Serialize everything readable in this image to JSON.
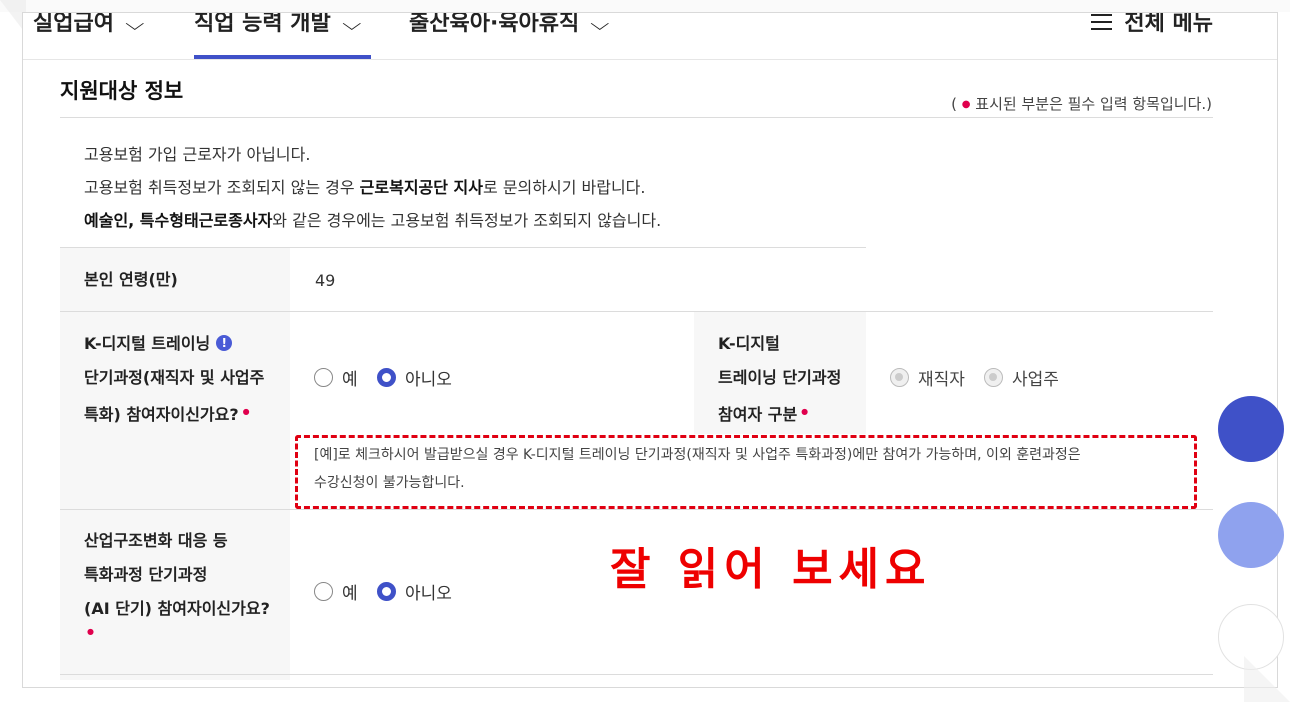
{
  "nav": {
    "items": [
      {
        "label": "실업급여"
      },
      {
        "label": "직업 능력 개발"
      },
      {
        "label": "출산육아·육아휴직"
      }
    ],
    "chevron": "⌵",
    "menu_label": "전체 메뉴"
  },
  "section": {
    "title": "지원대상 정보",
    "required_note_prefix": "(",
    "required_note_text": "표시된 부분은 필수 입력 항목입니다.)"
  },
  "notice": {
    "line1": "고용보험 가입 근로자가 아닙니다.",
    "line2_pre": "고용보험 취득정보가 조회되지 않는 경우 ",
    "line2_bold": "근로복지공단 지사",
    "line2_post": "로 문의하시기 바랍니다.",
    "line3_bold": "예술인, 특수형태근로종사자",
    "line3_post": "와 같은 경우에는 고용보험 취득정보가 조회되지 않습니다."
  },
  "table": {
    "age_label": "본인 연령(만)",
    "age_value": "49",
    "kdigital": {
      "label_l1": "K-디지털 트레이닝",
      "label_l2": "단기과정(재직자 및 사업주",
      "label_l3": "특화) 참여자이신가요?",
      "yes": "예",
      "no": "아니오",
      "selected": "아니오",
      "type_label_l1": "K-디지털",
      "type_label_l2": "트레이닝 단기과정",
      "type_label_l3": "참여자 구분",
      "type_opt1": "재직자",
      "type_opt2": "사업주",
      "info_glyph": "!",
      "notice_l1": "[예]로 체크하시어 발급받으실 경우 K-디지털 트레이닝 단기과정(재직자 및 사업주 특화과정)에만 참여가 가능하며, 이외 훈련과정은",
      "notice_l2": "수강신청이 불가능합니다."
    },
    "industry": {
      "label_l1": "산업구조변화 대응 등",
      "label_l2": "특화과정 단기과정",
      "label_l3": "(AI 단기) 참여자이신가요?",
      "yes": "예",
      "no": "아니오",
      "selected": "아니오"
    }
  },
  "caption": "잘 읽어 보세요",
  "req_dot": "●",
  "colors": {
    "accent": "#3f51c8",
    "required": "#e0004d",
    "highlight": "#e00012",
    "caption": "#ee0000"
  },
  "icons": [
    "chevron-down-icon",
    "hamburger-menu-icon",
    "info-icon",
    "required-dot-icon"
  ]
}
